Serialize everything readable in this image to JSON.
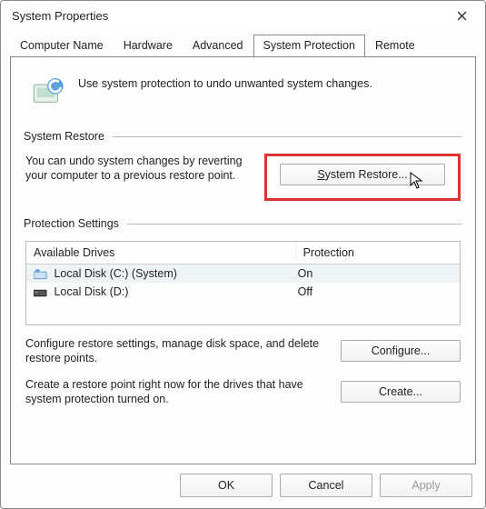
{
  "window": {
    "title": "System Properties"
  },
  "tabs": [
    "Computer Name",
    "Hardware",
    "Advanced",
    "System Protection",
    "Remote"
  ],
  "intro": "Use system protection to undo unwanted system changes.",
  "section_restore": {
    "title": "System Restore",
    "text": "You can undo system changes by reverting your computer to a previous restore point.",
    "button": "ystem Restore..."
  },
  "section_protection": {
    "title": "Protection Settings",
    "columns": [
      "Available Drives",
      "Protection"
    ],
    "drives": [
      {
        "name": "Local Disk (C:) (System)",
        "protection": "On"
      },
      {
        "name": "Local Disk (D:)",
        "protection": "Off"
      }
    ],
    "configure_text": "Configure restore settings, manage disk space, and delete restore points.",
    "configure_button": "Configure...",
    "create_text": "Create a restore point right now for the drives that have system protection turned on.",
    "create_button": "Create..."
  },
  "footer": {
    "ok": "OK",
    "cancel": "Cancel",
    "apply": "Apply"
  }
}
